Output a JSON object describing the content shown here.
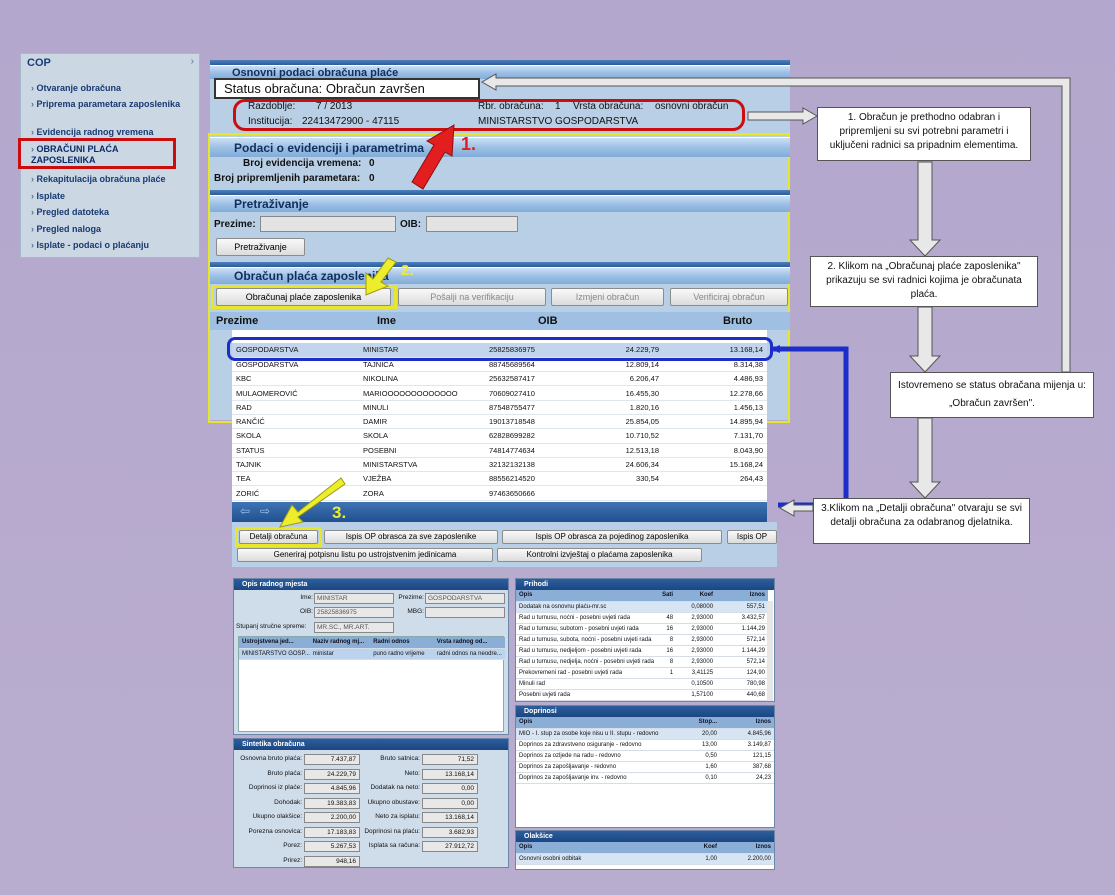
{
  "nav": {
    "title": "COP",
    "items": [
      {
        "label": "Otvaranje obračuna"
      },
      {
        "label": "Priprema parametara zaposlenika"
      },
      {
        "label": "Evidencija radnog vremena"
      },
      {
        "label": "OBRAČUNI PLAĆA ZAPOSLENIKA"
      },
      {
        "label": "Rekapitulacija obračuna plaće"
      },
      {
        "label": "Isplate"
      },
      {
        "label": "Pregled datoteka"
      },
      {
        "label": "Pregled naloga"
      },
      {
        "label": "Isplate - podaci o plaćanju"
      }
    ]
  },
  "basic": {
    "title": "Osnovni podaci obračuna plaće",
    "status": "Status obračuna: Obračun završen",
    "period_label": "Razdoblje:",
    "period_value": "7 / 2013",
    "rbr_label": "Rbr. obračuna:",
    "rbr_value": "1",
    "vrsta_label": "Vrsta obračuna:",
    "vrsta_value": "osnovni obračun",
    "inst_label": "Institucija:",
    "inst_value": "22413472900 - 47115",
    "inst_name": "MINISTARSTVO GOSPODARSTVA"
  },
  "evid": {
    "title": "Podaci o evidenciji i parametrima",
    "line1_label": "Broj evidencija vremena:",
    "line1_value": "0",
    "line2_label": "Broj pripremljenih parametara:",
    "line2_value": "0"
  },
  "search": {
    "title": "Pretraživanje",
    "prezime_label": "Prezime:",
    "oib_label": "OIB:",
    "button": "Pretraživanje"
  },
  "calc": {
    "title": "Obračun plaća zaposlenika",
    "buttons": [
      "Obračunaj plaće zaposlenika",
      "Pošalji na verifikaciju",
      "Izmjeni obračun",
      "Verificiraj obračun"
    ],
    "columns": [
      "Prezime",
      "Ime",
      "OIB",
      "Bruto"
    ],
    "rows": [
      [
        "GOSPODARSTVA",
        "MINISTAR",
        "25825836975",
        "24.229,79",
        "13.168,14"
      ],
      [
        "GOSPODARSTVA",
        "TAJNICA",
        "88745689564",
        "12.809,14",
        "8.314,38"
      ],
      [
        "KBC",
        "NIKOLINA",
        "25632587417",
        "6.206,47",
        "4.486,93"
      ],
      [
        "MULAOMEROVIĆ",
        "MARIOOOOOOOOOOOOO",
        "70609027410",
        "16.455,30",
        "12.278,66"
      ],
      [
        "RAD",
        "MINULI",
        "87548755477",
        "1.820,16",
        "1.456,13"
      ],
      [
        "RANČIĆ",
        "DAMIR",
        "19013718548",
        "25.854,05",
        "14.895,94"
      ],
      [
        "SKOLA",
        "SKOLA",
        "62828699282",
        "10.710,52",
        "7.131,70"
      ],
      [
        "STATUS",
        "POSEBNI",
        "74814774634",
        "12.513,18",
        "8.043,90"
      ],
      [
        "TAJNIK",
        "MINISTARSTVA",
        "32132132138",
        "24.606,34",
        "15.168,24"
      ],
      [
        "TEA",
        "VJEŽBA",
        "88556214520",
        "330,54",
        "264,43"
      ],
      [
        "ZORIĆ",
        "ZORA",
        "97463650666",
        "",
        ""
      ]
    ],
    "bottom_buttons": [
      "Detalji obračuna",
      "Ispis OP obrasca za sve zaposlenike",
      "Ispis OP obrasca za pojedinog zaposlenika",
      "Ispis OP",
      "Generiraj potpisnu listu po ustrojstvenim jedinicama",
      "Kontrolni izvještaj o plaćama zaposlenika"
    ]
  },
  "callouts": {
    "c1": "1. Obračun je prethodno odabran i pripremljeni su svi potrebni parametri i uključeni radnici sa pripadnim elementima.",
    "c2": "2. Klikom na „Obračunaj plaće zaposlenika\" prikazuju se svi radnici kojima je obračunata plaća.",
    "c3": "Istovremeno se status obračana mijenja u: „Obračun završen\".",
    "c4": "3.Klikom na „Detalji obračuna\" otvaraju se svi detalji obračuna za odabranog djelatnika.",
    "n1": "1.",
    "n2": "2.",
    "n3": "3."
  },
  "detail": {
    "opis_title": "Opis radnog mjesta",
    "ime_label": "Ime:",
    "ime_value": "MINISTAR",
    "prezime_label": "Prezime:",
    "prezime_value": "GOSPODARSTVA",
    "oib_label": "OIB:",
    "oib_value": "25825836975",
    "mbg_label": "MBG:",
    "ss_label": "Stupanj stručne spreme:",
    "ss_value": "MR.SC., MR.ART.",
    "uj_cols": [
      "Ustrojstvena jed...",
      "Naziv radnog mj...",
      "Radni odnos",
      "Vrsta radnog od..."
    ],
    "uj_row": [
      "MINISTARSTVO GOSP...",
      "ministar",
      "puno radno vrijeme",
      "radni odnos na neodre..."
    ],
    "sint_title": "Sintetika obračuna",
    "sint": [
      [
        "Osnovna bruto plaća:",
        "7.437,87",
        "Bruto satnica:",
        "71,52"
      ],
      [
        "Bruto plaća:",
        "24.229,79",
        "Neto:",
        "13.168,14"
      ],
      [
        "Doprinosi iz plaće:",
        "4.845,96",
        "Dodatak na neto:",
        "0,00"
      ],
      [
        "Dohodak:",
        "19.383,83",
        "Ukupno obustave:",
        "0,00"
      ],
      [
        "Ukupno olakšice:",
        "2.200,00",
        "Neto za isplatu:",
        "13.168,14"
      ],
      [
        "Porezna osnovica:",
        "17.183,83",
        "Doprinosi na plaću:",
        "3.682,93"
      ],
      [
        "Porez:",
        "5.267,53",
        "Isplata sa računa:",
        "27.912,72"
      ],
      [
        "Prirez:",
        "948,16",
        "",
        ""
      ]
    ],
    "prihodi_title": "Prihodi",
    "prihodi_cols": [
      "Opis",
      "Sati",
      "Koef",
      "Iznos"
    ],
    "prihodi": [
      [
        "Dodatak na osnovnu plaću-mr.sc",
        "",
        "0,08000",
        "557,51"
      ],
      [
        "Rad u turnusu, noćni - posebni uvjeti rada",
        "48",
        "2,93000",
        "3.432,57"
      ],
      [
        "Rad u turnusu, subotom - posebni uvjeti rada",
        "16",
        "2,93000",
        "1.144,29"
      ],
      [
        "Rad u turnusu, subota, noćni - posebni uvjeti rada",
        "8",
        "2,93000",
        "572,14"
      ],
      [
        "Rad u turnusu, nedjeljom - posebni uvjeti rada",
        "16",
        "2,93000",
        "1.144,29"
      ],
      [
        "Rad u turnusu, nedjelja, noćni - posebni uvjeti rada",
        "8",
        "2,93000",
        "572,14"
      ],
      [
        "Prekovremeni rad - posebni uvjeti rada",
        "1",
        "3,41125",
        "124,90"
      ],
      [
        "Minuli rad",
        "",
        "0,10500",
        "780,98"
      ],
      [
        "Posebni uvjeti rada",
        "",
        "1,57100",
        "440,68"
      ]
    ],
    "doprinosi_title": "Doprinosi",
    "doprinosi_cols": [
      "Opis",
      "Stop...",
      "Iznos"
    ],
    "doprinosi": [
      [
        "MIO - I. stup za osobe koje nisu u II. stupu - redovno",
        "20,00",
        "4.845,96"
      ],
      [
        "Doprinos za zdravstveno osiguranje - redovno",
        "13,00",
        "3.149,87"
      ],
      [
        "Doprinos za ozljede na radu - redovno",
        "0,50",
        "121,15"
      ],
      [
        "Doprinos za zapošljavanje - redovno",
        "1,60",
        "387,68"
      ],
      [
        "Doprinos za zapošljavanje inv. - redovno",
        "0,10",
        "24,23"
      ]
    ],
    "olaksice_title": "Olakšice",
    "olaksice_cols": [
      "Opis",
      "Koef",
      "Iznos"
    ],
    "olaksice": [
      [
        "Osnovni osobni odbitak",
        "1,00",
        "2.200,00"
      ]
    ]
  }
}
